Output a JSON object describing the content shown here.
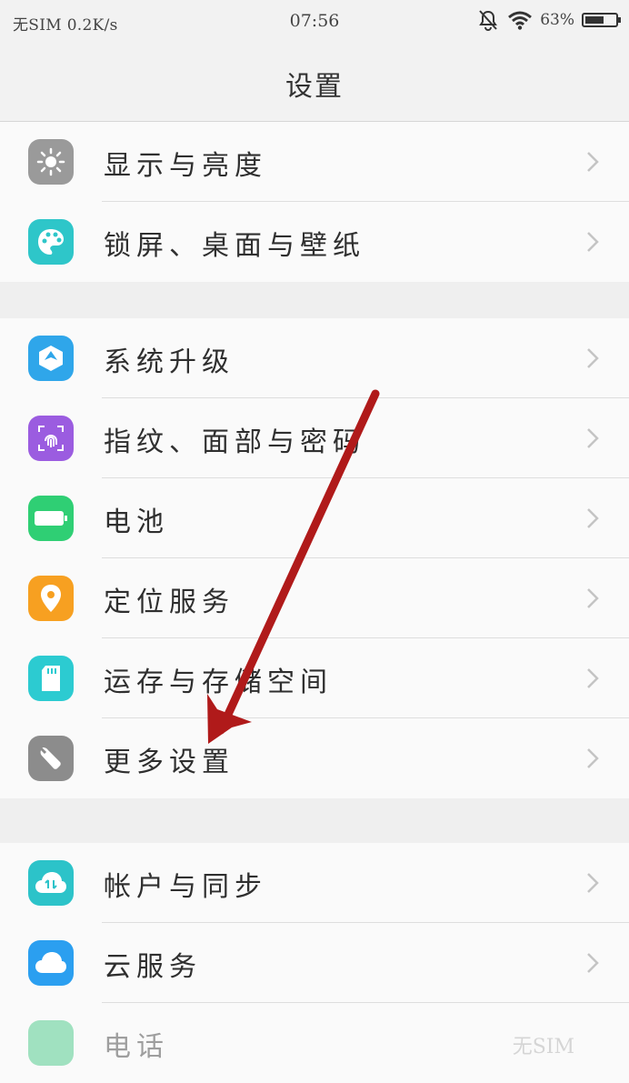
{
  "status": {
    "carrier": "无SIM",
    "speed": "0.2K/s",
    "time": "07:56",
    "battery": "63%",
    "battery_level": 0.63,
    "icons": [
      "bell-off-icon",
      "wifi-icon",
      "battery-icon"
    ]
  },
  "header": {
    "title": "设置"
  },
  "groups": [
    {
      "items": [
        {
          "label": "显示与亮度",
          "icon": "sun-icon",
          "color": "#9a9a9a"
        },
        {
          "label": "锁屏、桌面与壁纸",
          "icon": "palette-icon",
          "color": "#2ec6c9"
        }
      ]
    },
    {
      "items": [
        {
          "label": "系统升级",
          "icon": "upgrade-icon",
          "color": "#2fa6ea"
        },
        {
          "label": "指纹、面部与密码",
          "icon": "fingerprint-icon",
          "color": "#9b5ce0"
        },
        {
          "label": "电池",
          "icon": "battery-icon",
          "color": "#2fcf74"
        },
        {
          "label": "定位服务",
          "icon": "location-pin-icon",
          "color": "#f7a021"
        },
        {
          "label": "运存与存储空间",
          "icon": "sd-card-icon",
          "color": "#2ccbd1"
        },
        {
          "label": "更多设置",
          "icon": "wrench-icon",
          "color": "#8c8c8c"
        }
      ]
    },
    {
      "items": [
        {
          "label": "帐户与同步",
          "icon": "cloud-sync-icon",
          "color": "#2cc3c9"
        },
        {
          "label": "云服务",
          "icon": "cloud-icon",
          "color": "#2b9ff0"
        },
        {
          "label": "电话",
          "icon": "phone-icon",
          "color": "#35c37a",
          "value": "无SIM"
        }
      ]
    }
  ],
  "colors": {
    "annotation_arrow": "#b01a1a",
    "chevron": "#c4c4c4"
  }
}
